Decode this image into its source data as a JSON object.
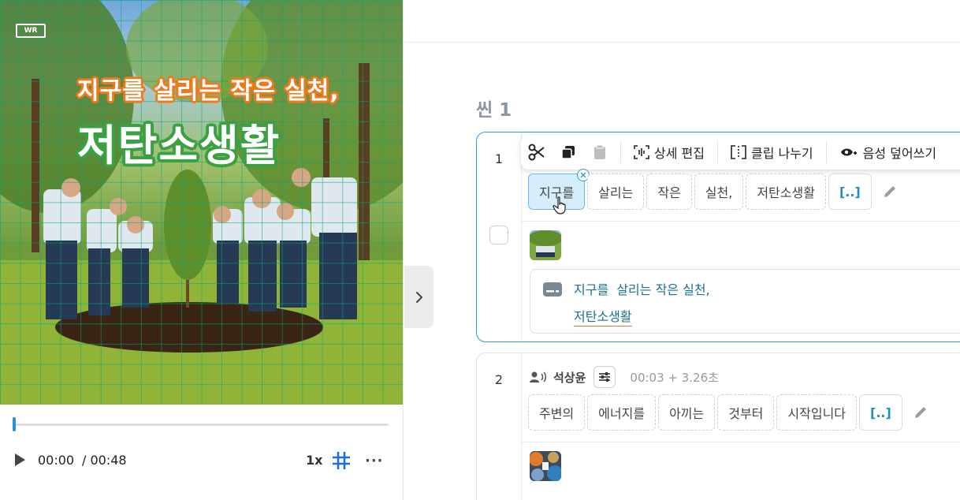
{
  "preview": {
    "logo_text": "WR",
    "caption_line1": "지구를  살리는 작은 실천,",
    "caption_line2": "저탄소생활"
  },
  "player": {
    "current_time": "00:00",
    "total_time": "/ 00:48",
    "speed": "1x",
    "more": "···",
    "progress": 0.0
  },
  "scene": {
    "title": "씬 1"
  },
  "toolbar": {
    "detail_edit": "상세 편집",
    "split_clip": "클립 나누기",
    "voice_overwrite": "음성 덮어쓰기"
  },
  "clips": [
    {
      "number": "1",
      "words": [
        "지구를",
        "살리는",
        "작은",
        "실천,",
        "저탄소생활",
        "[..]"
      ],
      "subtitle_line1": "지구를  살리는 작은 실천,",
      "subtitle_line2": "저탄소생활"
    },
    {
      "number": "2",
      "speaker": "석상윤",
      "timing": "00:03 + 3.26초",
      "words": [
        "주변의",
        "에너지를",
        "아끼는",
        "것부터",
        "시작입니다",
        "[..]"
      ]
    }
  ],
  "colors": {
    "accent": "#2b9ccf",
    "selected_word_bg": "#d6eefb",
    "subtitle_text": "#1c6f92",
    "caption_orange": "#f07a1a",
    "caption_green": "#3aa041"
  }
}
